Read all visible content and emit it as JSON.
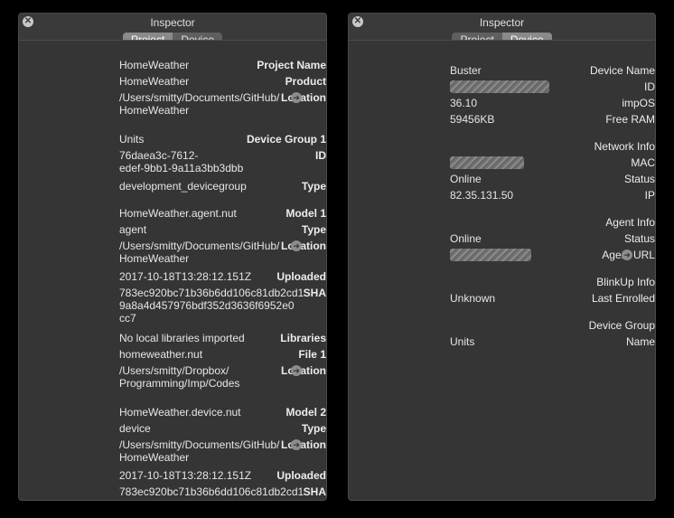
{
  "left": {
    "title": "Inspector",
    "tabs": [
      "Project",
      "Device"
    ],
    "fields": {
      "project_name_label": "Project Name",
      "project_name": "HomeWeather",
      "product_label": "Product",
      "product": "HomeWeather",
      "location_label": "Location",
      "location1_a": "/Users/smitty/Documents/GitHub/",
      "location1_b": "HomeWeather",
      "device_group_label": "Device Group 1",
      "device_group": "Units",
      "id_label": "ID",
      "id_a": "76daea3c-7612-",
      "id_b": "edef-9bb1-9a11a3bb3dbb",
      "type_label": "Type",
      "dg_type": "development_devicegroup",
      "model1_label": "Model 1",
      "model1": "HomeWeather.agent.nut",
      "model1_type": "agent",
      "model1_loc_a": "/Users/smitty/Documents/GitHub/",
      "model1_loc_b": "HomeWeather",
      "uploaded_label": "Uploaded",
      "model1_uploaded": "2017-10-18T13:28:12.151Z",
      "sha_label": "SHA",
      "sha_a": "783ec920bc71b36b6dd106c81db2cd1",
      "sha_b": "9a8a4d457976bdf352d3636f6952e0",
      "sha_c": "cc7",
      "libraries_label": "Libraries",
      "libraries": "No local libraries imported",
      "file1_label": "File 1",
      "file1": "homeweather.nut",
      "file1_loc_a": "/Users/smitty/Dropbox/",
      "file1_loc_b": "Programming/Imp/Codes",
      "model2_label": "Model 2",
      "model2": "HomeWeather.device.nut",
      "model2_type": "device",
      "model2_loc_a": "/Users/smitty/Documents/GitHub/",
      "model2_loc_b": "HomeWeather",
      "model2_uploaded": "2017-10-18T13:28:12.151Z",
      "model2_sha": "783ec920bc71b36b6dd106c81db2cd1"
    }
  },
  "right": {
    "title": "Inspector",
    "tabs": [
      "Project",
      "Device"
    ],
    "fields": {
      "device_name_label": "Device Name",
      "device_name": "Buster",
      "id_label": "ID",
      "impos_label": "impOS",
      "impos": "36.10",
      "free_ram_label": "Free RAM",
      "free_ram": "59456KB",
      "network_info_label": "Network Info",
      "mac_label": "MAC",
      "status_label": "Status",
      "net_status": "Online",
      "ip_label": "IP",
      "ip": "82.35.131.50",
      "agent_info_label": "Agent Info",
      "agent_status": "Online",
      "agent_url_label": "Agent URL",
      "blinkup_label": "BlinkUp Info",
      "last_enrolled_label": "Last Enrolled",
      "last_enrolled": "Unknown",
      "device_group_label": "Device Group",
      "name_label": "Name",
      "group_name": "Units"
    }
  },
  "icons": {
    "close": "close-icon",
    "go": "arrow-right-circle-icon"
  }
}
